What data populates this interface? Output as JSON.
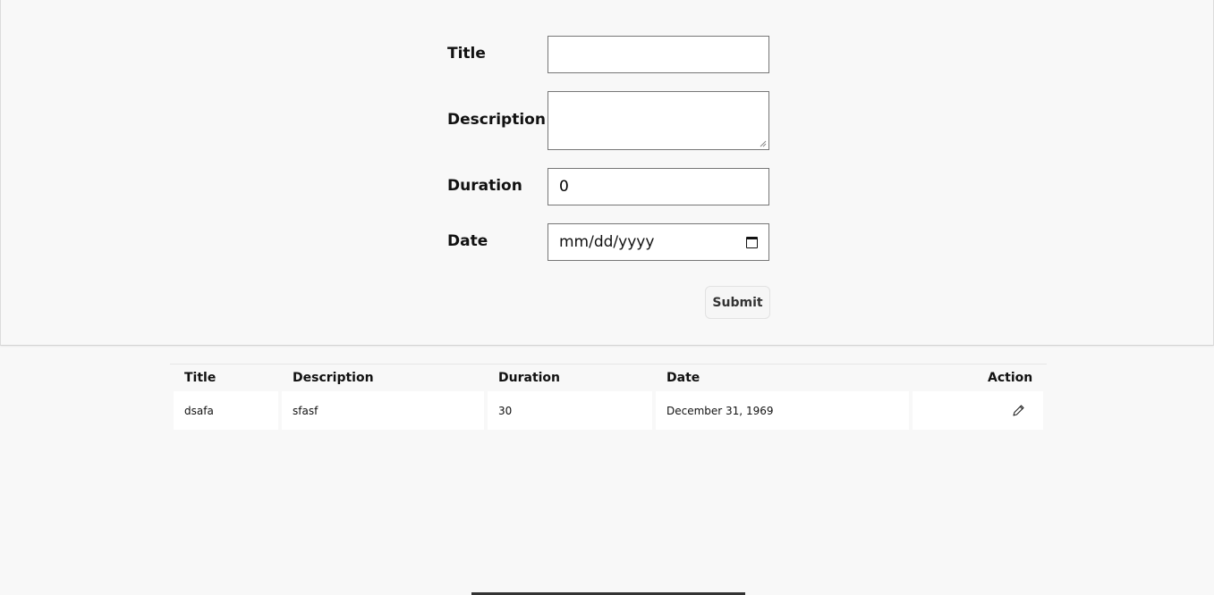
{
  "form": {
    "title_label": "Title",
    "title_value": "",
    "description_label": "Description",
    "description_value": "",
    "duration_label": "Duration",
    "duration_value": "0",
    "date_label": "Date",
    "date_placeholder": "mm/dd/yyyy",
    "date_icon": "calendar-icon",
    "submit_label": "Submit"
  },
  "table": {
    "headers": {
      "title": "Title",
      "description": "Description",
      "duration": "Duration",
      "date": "Date",
      "action": "Action"
    },
    "rows": [
      {
        "title": "dsafa",
        "description": "sfasf",
        "duration": "30",
        "date": "December 31, 1969",
        "action_icon": "pencil-edit-icon"
      }
    ]
  }
}
